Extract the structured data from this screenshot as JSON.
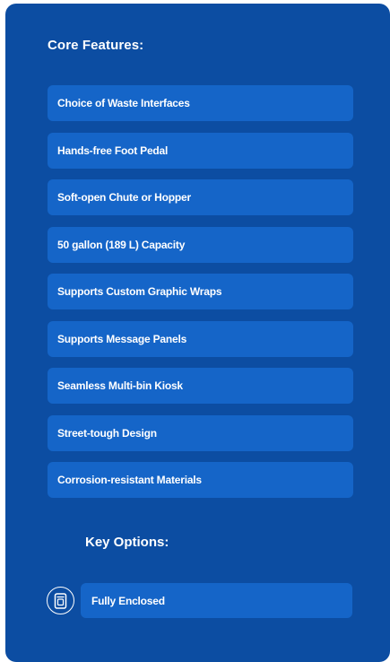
{
  "core_features": {
    "title": "Core Features:",
    "items": [
      {
        "label": "Choice of Waste Interfaces"
      },
      {
        "label": "Hands-free Foot Pedal"
      },
      {
        "label": "Soft-open Chute or Hopper"
      },
      {
        "label": "50 gallon (189 L) Capacity"
      },
      {
        "label": "Supports Custom Graphic Wraps"
      },
      {
        "label": "Supports Message Panels"
      },
      {
        "label": "Seamless Multi-bin Kiosk"
      },
      {
        "label": "Street-tough Design"
      },
      {
        "label": "Corrosion-resistant Materials"
      }
    ]
  },
  "key_options": {
    "title": "Key Options:",
    "items": [
      {
        "label": "Fully Enclosed",
        "icon": "enclosed-bin-icon"
      }
    ]
  },
  "colors": {
    "panel_bg": "#0c4da2",
    "item_bg": "#1565c8",
    "text": "#ffffff"
  }
}
